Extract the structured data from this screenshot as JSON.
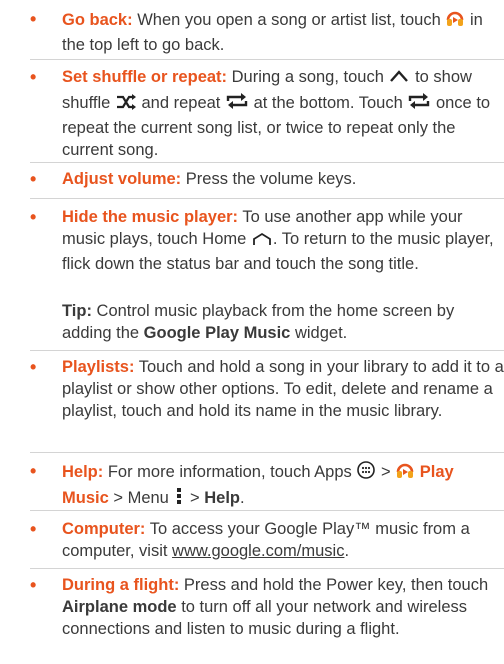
{
  "items": [
    {
      "heading": "Go back:",
      "text_a": " When you open a song or artist list, touch ",
      "text_b": " in the top left to go back.",
      "icon": "headphones-icon"
    },
    {
      "heading": "Set shuffle or repeat:",
      "text_a": " During a song, touch ",
      "text_b": " to show shuffle ",
      "text_c": " and repeat ",
      "text_d": " at the bottom. Touch ",
      "text_e": " once to repeat the current song list, or twice to repeat only the current song."
    },
    {
      "heading": "Adjust volume:",
      "text_a": " Press the volume keys."
    },
    {
      "heading": "Hide the music player:",
      "text_a": " To use another app while your music plays, touch Home ",
      "text_b": ". To return to the music player, flick down the status bar and touch the song title."
    },
    {
      "heading": "Playlists:",
      "text_a": " Touch and hold a song in your library to add it to a playlist or show other options. To edit, delete and rename a playlist, touch and hold its name in the music library."
    },
    {
      "heading": "Help:",
      "text_a": " For more information, touch Apps ",
      "text_b": " > ",
      "bold_a": "Play Music",
      "text_c": " > Menu ",
      "text_d": " > ",
      "bold_b": "Help",
      "text_e": "."
    },
    {
      "heading": "Computer:",
      "text_a": " To access your Google Play™ music from a computer, visit ",
      "link": "www.google.com/music",
      "text_b": "."
    },
    {
      "heading": "During a flight:",
      "text_a": " Press and hold the Power key, then touch ",
      "bold_a": "Airplane mode",
      "text_b": " to turn off all your network and wireless connections and listen to music during a flight."
    }
  ],
  "tip": {
    "label": "Tip:",
    "text_a": " Control music playback from the home screen by adding the ",
    "bold": "Google Play Music",
    "text_b": " widget."
  },
  "colors": {
    "accent": "#e8541e",
    "divider": "#d4d4d4",
    "text": "#3a3a3a"
  }
}
